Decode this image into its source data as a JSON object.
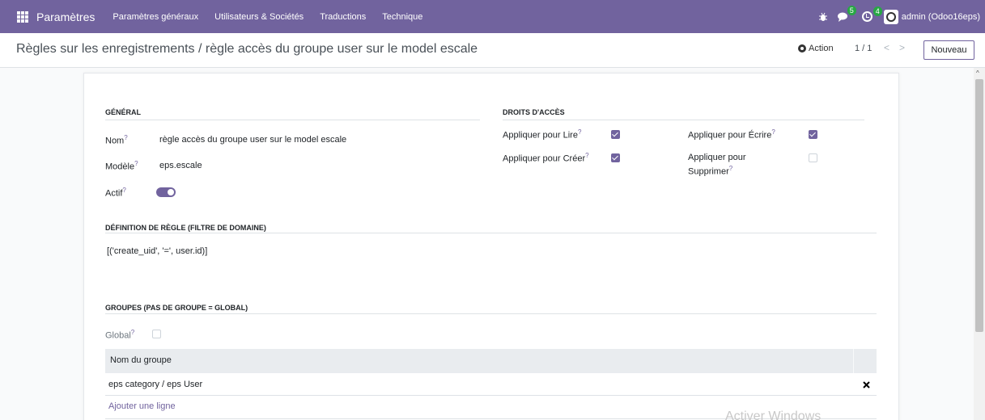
{
  "topbar": {
    "app_name": "Paramètres",
    "menu": [
      "Paramètres généraux",
      "Utilisateurs & Sociétés",
      "Traductions",
      "Technique"
    ],
    "messages_count": "5",
    "activities_count": "4",
    "user": "admin (Odoo16eps)",
    "color": "#71639e"
  },
  "control_panel": {
    "breadcrumb": "Règles sur les enregistrements / règle accès du groupe user sur le model escale",
    "action_label": "Action",
    "pager": "1 / 1",
    "pager_prev": "<",
    "pager_next": ">",
    "new_label": "Nouveau"
  },
  "form": {
    "general": {
      "title": "GÉNÉRAL",
      "name_label": "Nom",
      "name_value": "règle accès du groupe user sur le model escale",
      "model_label": "Modèle",
      "model_value": "eps.escale",
      "active_label": "Actif",
      "active": true
    },
    "access": {
      "title": "DROITS D'ACCÈS",
      "read_label": "Appliquer pour Lire",
      "read": true,
      "write_label": "Appliquer pour Écrire",
      "write": true,
      "create_label": "Appliquer pour Créer",
      "create": true,
      "delete_label_1": "Appliquer pour",
      "delete_label_2": "Supprimer",
      "delete": false
    },
    "domain": {
      "title": "DÉFINITION DE RÈGLE (FILTRE DE DOMAINE)",
      "value": "[('create_uid', '=', user.id)]"
    },
    "groups": {
      "title": "GROUPES (PAS DE GROUPE = GLOBAL)",
      "global_label": "Global",
      "global": false,
      "column": "Nom du groupe",
      "rows": [
        "eps category / eps User"
      ],
      "add_line": "Ajouter une ligne"
    }
  },
  "help_mark": "?",
  "watermark": "Activer Windows"
}
